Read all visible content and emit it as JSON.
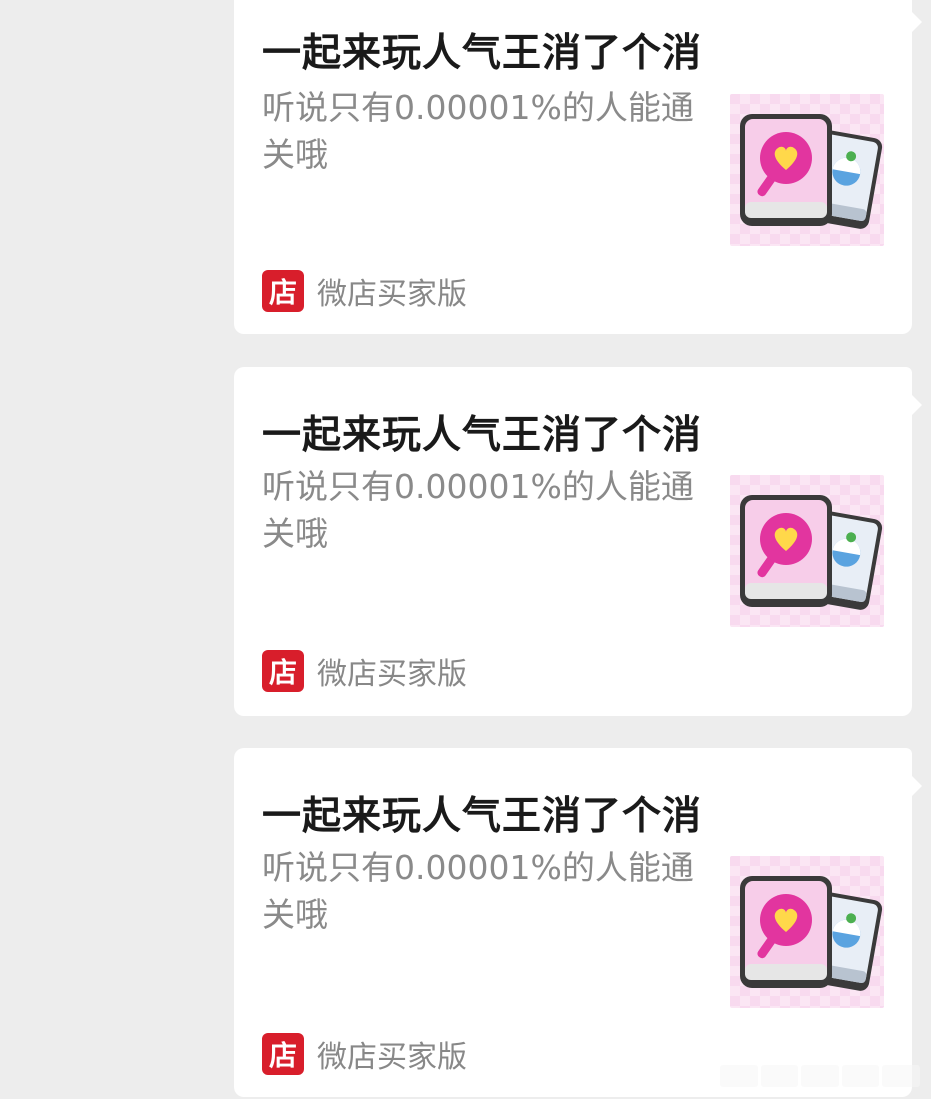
{
  "cards": [
    {
      "title": "一起来玩人气王消了个消",
      "description": "听说只有0.00001%的人能通关哦",
      "source_icon_text": "店",
      "source_name": "微店买家版",
      "thumbnail_icon": "heart-lollipop-tile-game-icon"
    },
    {
      "title": "一起来玩人气王消了个消",
      "description": "听说只有0.00001%的人能通关哦",
      "source_icon_text": "店",
      "source_name": "微店买家版",
      "thumbnail_icon": "heart-lollipop-tile-game-icon"
    },
    {
      "title": "一起来玩人气王消了个消",
      "description": "听说只有0.00001%的人能通关哦",
      "source_icon_text": "店",
      "source_name": "微店买家版",
      "thumbnail_icon": "heart-lollipop-tile-game-icon"
    }
  ],
  "colors": {
    "background": "#ededed",
    "card": "#ffffff",
    "source_brand": "#d81e2b",
    "thumbnail_bg": "#fbe3f3",
    "tile_pink": "#f5c6e6",
    "heart_magenta": "#e2359f"
  }
}
